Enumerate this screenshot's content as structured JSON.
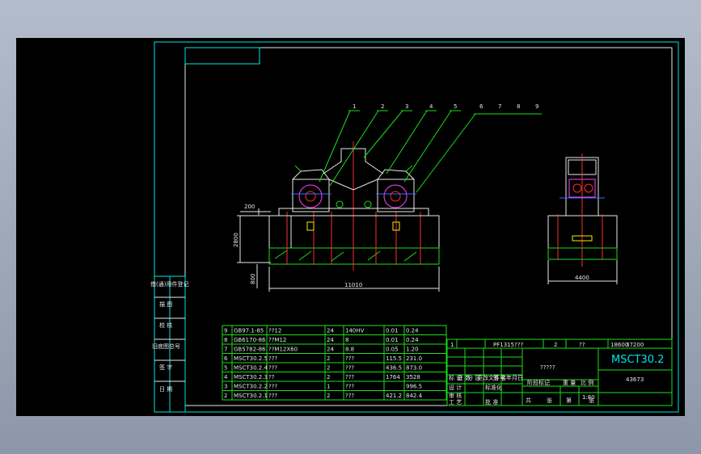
{
  "drawing": {
    "part_numbers": [
      "1",
      "2",
      "3",
      "4",
      "5",
      "6",
      "7",
      "8",
      "9"
    ],
    "dimensions": {
      "left_offset": "200",
      "height": "2800",
      "foundation": "800",
      "total_length": "11010",
      "side_width": "4400"
    },
    "left_stamp": [
      "借(通)用件登记",
      "描 图",
      "校 核",
      "旧底图总号",
      "签 字",
      "日 期"
    ],
    "parts_list": [
      {
        "no": "9",
        "code": "GB97.1-85",
        "name": "??12",
        "qty": "24",
        "material": "140HV",
        "unit": "0.01",
        "total": "0.24"
      },
      {
        "no": "8",
        "code": "GB6170-86",
        "name": "??M12",
        "qty": "24",
        "material": "8",
        "unit": "0.01",
        "total": "0.24"
      },
      {
        "no": "7",
        "code": "GB5782-86",
        "name": "??M12X60",
        "qty": "24",
        "material": "8.8",
        "unit": "0.05",
        "total": "1.20"
      },
      {
        "no": "6",
        "code": "MSCT30.2.5",
        "name": "???",
        "qty": "2",
        "material": "???",
        "unit": "115.5",
        "total": "231.0"
      },
      {
        "no": "5",
        "code": "MSCT30.2.4",
        "name": "???",
        "qty": "2",
        "material": "???",
        "unit": "436.5",
        "total": "873.0"
      },
      {
        "no": "4",
        "code": "MSCT30.2.3",
        "name": "??",
        "qty": "2",
        "material": "???",
        "unit": "1764",
        "total": "3528"
      },
      {
        "no": "3",
        "code": "MSCT30.2.2",
        "name": "???",
        "qty": "1",
        "material": "???",
        "unit": "",
        "total": "996.5"
      },
      {
        "no": "2",
        "code": "MSCT30.2.1",
        "name": "???",
        "qty": "2",
        "material": "???",
        "unit": "421.2",
        "total": "842.4"
      }
    ],
    "title_block": {
      "row_no": "1",
      "spec": "PF1315???",
      "qty": "2",
      "code2": "??",
      "weight_field": "18600",
      "weight_field2": "37200",
      "title_cn": "?????",
      "drawing_no": "MSCT30.2",
      "weight": "43673",
      "scale": "1:80",
      "small_labels": [
        "标 记",
        "处 数",
        "分 区",
        "更改文件号",
        "签 名",
        "年月日"
      ],
      "row_labels": [
        "设 计",
        "标准化",
        "审 核",
        "工 艺",
        "批 准"
      ],
      "stage_labels": [
        "阶段标记",
        "重 量",
        "比 例"
      ],
      "sheet_labels": [
        "共",
        "张",
        "第",
        "张"
      ]
    }
  }
}
